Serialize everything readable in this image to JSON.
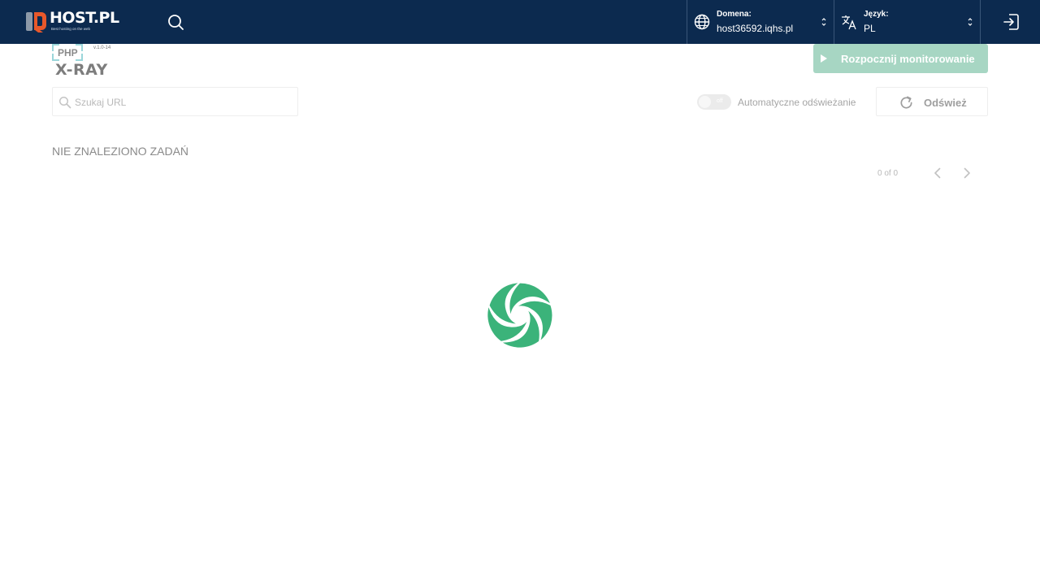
{
  "nav": {
    "brand": "HOST.PL",
    "tagline": "Best hosting on the web",
    "domain": {
      "label": "Domena:",
      "value": "host36592.iqhs.pl"
    },
    "language": {
      "label": "Język:",
      "value": "PL"
    }
  },
  "app": {
    "php_label": "PHP",
    "version": "v.1.0-14",
    "title": "X-RAY",
    "start_button": "Rozpocznij monitorowanie"
  },
  "toolbar": {
    "search_placeholder": "Szukaj URL",
    "toggle_state": "off",
    "auto_refresh_label": "Automatyczne odświeżanie",
    "refresh_button": "Odśwież"
  },
  "results": {
    "empty_message": "NIE ZNALEZIONO ZADAŃ",
    "pagination": "0 of 0"
  },
  "colors": {
    "navbar": "#0c2a4f",
    "accent": "#3bb37a",
    "accent_disabled": "#a7d6c3",
    "brand_orange": "#e8582b"
  }
}
